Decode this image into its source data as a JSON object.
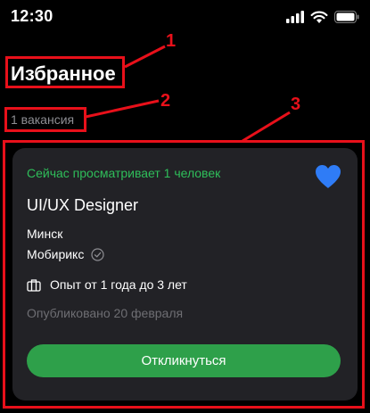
{
  "status_bar": {
    "time": "12:30"
  },
  "header": {
    "title": "Избранное",
    "count": "1 вакансия"
  },
  "annotations": [
    "1",
    "2",
    "3"
  ],
  "vacancy_card": {
    "viewing_text": "Сейчас просматривает 1 человек",
    "title": "UI/UX Designer",
    "city": "Минск",
    "company": "Мобирикс",
    "experience": "Опыт от 1 года до 3 лет",
    "published": "Опубликовано 20 февраля",
    "respond_label": "Откликнуться",
    "favorite": true
  },
  "colors": {
    "background": "#000000",
    "card": "#222226",
    "accent_green": "#2ea04a",
    "viewing_green": "#2fbe5a",
    "heart_blue": "#2f7cf6",
    "annotation_red": "#e8101a"
  },
  "icons": [
    "signal-icon",
    "wifi-icon",
    "battery-icon",
    "heart-icon",
    "verified-check-icon",
    "briefcase-icon"
  ]
}
